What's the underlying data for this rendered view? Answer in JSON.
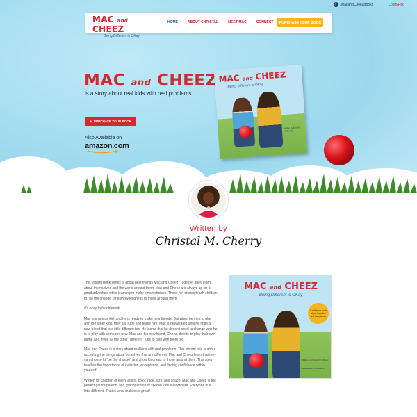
{
  "topbar": {
    "facebook_label": "/MacandCheezBooks",
    "login_label": "Login/Reg"
  },
  "nav": {
    "logo_main": "MAC",
    "logo_and": "and",
    "logo_main2": "CHEEZ",
    "logo_sub": "Being Different is OKay",
    "links": [
      "HOME",
      "ABOUT CHRISTAL",
      "MEET MAC",
      "CONNECT"
    ],
    "cta": "PURCHASE YOUR BOOK"
  },
  "hero": {
    "title_a": "MAC",
    "title_and": "and",
    "title_b": "CHEEZ",
    "description": "is a story about real kids with real problems.",
    "button": "PURCHASE YOUR BOOK",
    "available": "Also Available on",
    "amazon": "amazon.com"
  },
  "book_cover": {
    "title_a": "MAC",
    "title_and": "and",
    "title_b": "CHEEZ",
    "subtitle": "Being Different is OKay",
    "written_by": "Written by Christal M. Cherry",
    "illustrated_by": "Illustrated by L. Modesty",
    "badge": "A children's book about inclusion and acceptance"
  },
  "author": {
    "written_by": "Written by",
    "name": "Christal M. Cherry"
  },
  "body": {
    "p1": "This vibrant book series is about best friends Mac and Cheez. Together, they learn about themselves and the world around them.  Mac and Cheez are always up for a good adventure while learning to make smart choices. These fun stories teach children to \"be the change\" and show kindness to those around them.",
    "p2": "It's okay to be different!",
    "p3": "Mac is a unique kid, and he is ready to make new friends! But when he tries to play with the other kids, they are rude and tease him. Mac is devastated until he finds a new friend that is a little different too. He learns that he doesn't need to change who he is to play with someone new. Mac and his new friend, Cheez, decide to play their own game and invite all the other \"different\" kids to play with them too.",
    "p4": "Mac and Cheez is a story about real kids with real problems. This vibrant tale is about accepting the things about ourselves that are different. Mac and Cheez learn that they can choose to \"be the change\" and show kindness to those around them. This story teaches the importance of inclusion, acceptance, and finding confidence within yourself.",
    "p5": "Written for children of every ability, color, race, size, and shape, Mac and Cheez is the perfect gift for parents and grandparents of special kids everywhere. Everyone is a little different. That is what makes us great!"
  },
  "colors": {
    "brand_red": "#d22a33",
    "brand_blue": "#2d5ea8",
    "cta_yellow": "#f7b617",
    "sky": "#a9e0f2"
  }
}
